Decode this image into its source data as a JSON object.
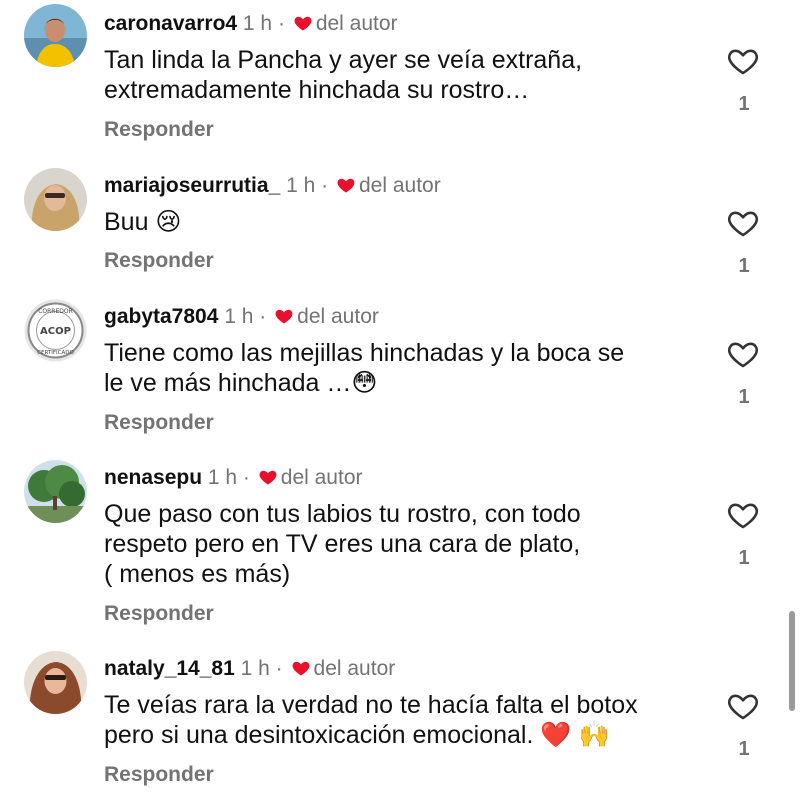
{
  "meta": {
    "time": "1 h",
    "dot": "·",
    "liked_label": "del autor",
    "reply_label": "Responder"
  },
  "colors": {
    "heart": "#e8112d",
    "muted": "#737373",
    "text": "#111111"
  },
  "comments": [
    {
      "username": "caronavarro4",
      "text_line1": "Tan linda la Pancha y ayer se veía extraña,",
      "text_line2": "extremadamente hinchada su rostro…",
      "likes": "1"
    },
    {
      "username": "mariajoseurrutia_",
      "text_line1": "Buu 😢",
      "likes": "1"
    },
    {
      "username": "gabyta7804",
      "text_line1": "Tiene como las mejillas hinchadas y la boca se",
      "text_line2": "le ve más hinchada …😳",
      "likes": "1",
      "avatar_text": {
        "top": "CORREDOR",
        "center": "ACOP",
        "bottom": "CERTIFICADO"
      }
    },
    {
      "username": "nenasepu",
      "text_line1": "Que paso con tus labios tu rostro, con todo",
      "text_line2": "respeto pero en TV eres una cara de plato,",
      "text_line3": "( menos es más)",
      "likes": "1"
    },
    {
      "username": "nataly_14_81",
      "text_line1": "Te veías rara la verdad no te hacía falta el botox",
      "text_line2": "pero si una desintoxicación emocional. ❤️ 🙌",
      "likes": "1"
    }
  ]
}
